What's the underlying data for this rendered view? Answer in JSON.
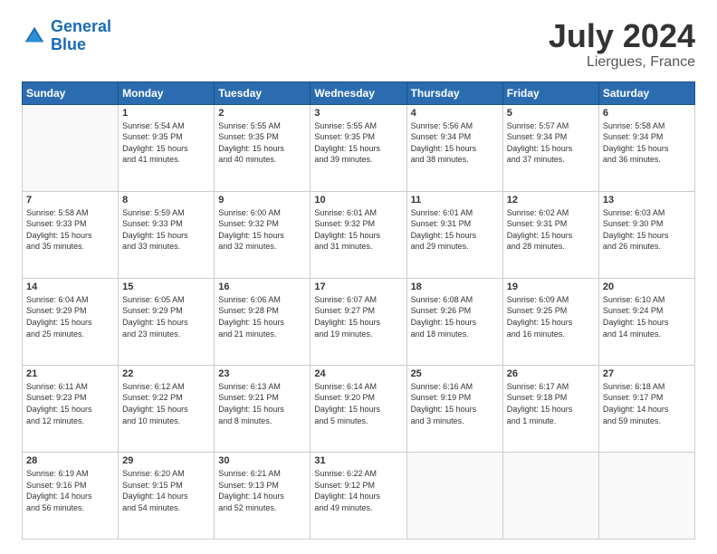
{
  "header": {
    "logo_line1": "General",
    "logo_line2": "Blue",
    "main_title": "July 2024",
    "sub_title": "Liergues, France"
  },
  "columns": [
    "Sunday",
    "Monday",
    "Tuesday",
    "Wednesday",
    "Thursday",
    "Friday",
    "Saturday"
  ],
  "weeks": [
    [
      {
        "day": "",
        "info": ""
      },
      {
        "day": "1",
        "info": "Sunrise: 5:54 AM\nSunset: 9:35 PM\nDaylight: 15 hours\nand 41 minutes."
      },
      {
        "day": "2",
        "info": "Sunrise: 5:55 AM\nSunset: 9:35 PM\nDaylight: 15 hours\nand 40 minutes."
      },
      {
        "day": "3",
        "info": "Sunrise: 5:55 AM\nSunset: 9:35 PM\nDaylight: 15 hours\nand 39 minutes."
      },
      {
        "day": "4",
        "info": "Sunrise: 5:56 AM\nSunset: 9:34 PM\nDaylight: 15 hours\nand 38 minutes."
      },
      {
        "day": "5",
        "info": "Sunrise: 5:57 AM\nSunset: 9:34 PM\nDaylight: 15 hours\nand 37 minutes."
      },
      {
        "day": "6",
        "info": "Sunrise: 5:58 AM\nSunset: 9:34 PM\nDaylight: 15 hours\nand 36 minutes."
      }
    ],
    [
      {
        "day": "7",
        "info": "Sunrise: 5:58 AM\nSunset: 9:33 PM\nDaylight: 15 hours\nand 35 minutes."
      },
      {
        "day": "8",
        "info": "Sunrise: 5:59 AM\nSunset: 9:33 PM\nDaylight: 15 hours\nand 33 minutes."
      },
      {
        "day": "9",
        "info": "Sunrise: 6:00 AM\nSunset: 9:32 PM\nDaylight: 15 hours\nand 32 minutes."
      },
      {
        "day": "10",
        "info": "Sunrise: 6:01 AM\nSunset: 9:32 PM\nDaylight: 15 hours\nand 31 minutes."
      },
      {
        "day": "11",
        "info": "Sunrise: 6:01 AM\nSunset: 9:31 PM\nDaylight: 15 hours\nand 29 minutes."
      },
      {
        "day": "12",
        "info": "Sunrise: 6:02 AM\nSunset: 9:31 PM\nDaylight: 15 hours\nand 28 minutes."
      },
      {
        "day": "13",
        "info": "Sunrise: 6:03 AM\nSunset: 9:30 PM\nDaylight: 15 hours\nand 26 minutes."
      }
    ],
    [
      {
        "day": "14",
        "info": "Sunrise: 6:04 AM\nSunset: 9:29 PM\nDaylight: 15 hours\nand 25 minutes."
      },
      {
        "day": "15",
        "info": "Sunrise: 6:05 AM\nSunset: 9:29 PM\nDaylight: 15 hours\nand 23 minutes."
      },
      {
        "day": "16",
        "info": "Sunrise: 6:06 AM\nSunset: 9:28 PM\nDaylight: 15 hours\nand 21 minutes."
      },
      {
        "day": "17",
        "info": "Sunrise: 6:07 AM\nSunset: 9:27 PM\nDaylight: 15 hours\nand 19 minutes."
      },
      {
        "day": "18",
        "info": "Sunrise: 6:08 AM\nSunset: 9:26 PM\nDaylight: 15 hours\nand 18 minutes."
      },
      {
        "day": "19",
        "info": "Sunrise: 6:09 AM\nSunset: 9:25 PM\nDaylight: 15 hours\nand 16 minutes."
      },
      {
        "day": "20",
        "info": "Sunrise: 6:10 AM\nSunset: 9:24 PM\nDaylight: 15 hours\nand 14 minutes."
      }
    ],
    [
      {
        "day": "21",
        "info": "Sunrise: 6:11 AM\nSunset: 9:23 PM\nDaylight: 15 hours\nand 12 minutes."
      },
      {
        "day": "22",
        "info": "Sunrise: 6:12 AM\nSunset: 9:22 PM\nDaylight: 15 hours\nand 10 minutes."
      },
      {
        "day": "23",
        "info": "Sunrise: 6:13 AM\nSunset: 9:21 PM\nDaylight: 15 hours\nand 8 minutes."
      },
      {
        "day": "24",
        "info": "Sunrise: 6:14 AM\nSunset: 9:20 PM\nDaylight: 15 hours\nand 5 minutes."
      },
      {
        "day": "25",
        "info": "Sunrise: 6:16 AM\nSunset: 9:19 PM\nDaylight: 15 hours\nand 3 minutes."
      },
      {
        "day": "26",
        "info": "Sunrise: 6:17 AM\nSunset: 9:18 PM\nDaylight: 15 hours\nand 1 minute."
      },
      {
        "day": "27",
        "info": "Sunrise: 6:18 AM\nSunset: 9:17 PM\nDaylight: 14 hours\nand 59 minutes."
      }
    ],
    [
      {
        "day": "28",
        "info": "Sunrise: 6:19 AM\nSunset: 9:16 PM\nDaylight: 14 hours\nand 56 minutes."
      },
      {
        "day": "29",
        "info": "Sunrise: 6:20 AM\nSunset: 9:15 PM\nDaylight: 14 hours\nand 54 minutes."
      },
      {
        "day": "30",
        "info": "Sunrise: 6:21 AM\nSunset: 9:13 PM\nDaylight: 14 hours\nand 52 minutes."
      },
      {
        "day": "31",
        "info": "Sunrise: 6:22 AM\nSunset: 9:12 PM\nDaylight: 14 hours\nand 49 minutes."
      },
      {
        "day": "",
        "info": ""
      },
      {
        "day": "",
        "info": ""
      },
      {
        "day": "",
        "info": ""
      }
    ]
  ]
}
